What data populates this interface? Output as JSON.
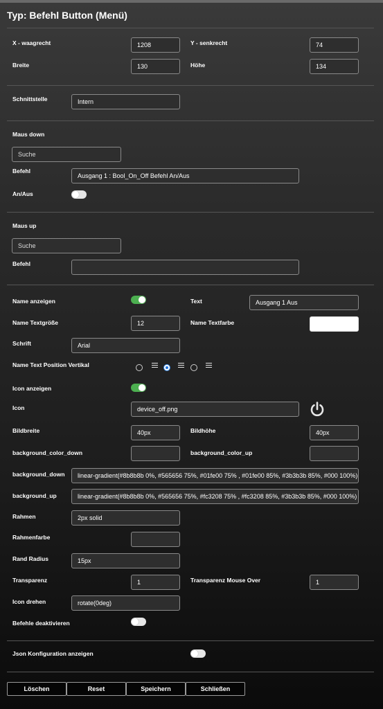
{
  "dialog": {
    "title": "Typ: Befehl Button (Menü)"
  },
  "position": {
    "x_label": "X - waagrecht",
    "x_value": "1208",
    "y_label": "Y - senkrecht",
    "y_value": "74",
    "width_label": "Breite",
    "width_value": "130",
    "height_label": "Höhe",
    "height_value": "134"
  },
  "interface": {
    "label": "Schnittstelle",
    "value": "Intern"
  },
  "mouse_down": {
    "heading": "Maus down",
    "search_value": "Suche",
    "command_label": "Befehl",
    "command_value": "Ausgang 1 : Bool_On_Off Befehl An/Aus",
    "onoff_label": "An/Aus",
    "onoff_state": "off"
  },
  "mouse_up": {
    "heading": "Maus up",
    "search_value": "Suche",
    "command_label": "Befehl",
    "command_value": ""
  },
  "appearance": {
    "show_name_label": "Name anzeigen",
    "show_name_state": "on",
    "text_label": "Text",
    "text_value": "Ausgang 1 Aus",
    "name_size_label": "Name Textgröße",
    "name_size_value": "12",
    "name_color_label": "Name Textfarbe",
    "name_color_value": "#ffffff",
    "font_label": "Schrift",
    "font_value": "Arial",
    "text_pos_label": "Name Text Position Vertikal",
    "text_pos_options": [
      "top",
      "middle",
      "bottom"
    ],
    "text_pos_selected": "middle",
    "show_icon_label": "Icon anzeigen",
    "show_icon_state": "on",
    "icon_label": "Icon",
    "icon_value": "device_off.png",
    "icon_preview": "power-icon",
    "img_width_label": "Bildbreite",
    "img_width_value": "40px",
    "img_height_label": "Bildhöhe",
    "img_height_value": "40px",
    "bg_color_down_label": "background_color_down",
    "bg_color_down_value": "",
    "bg_color_up_label": "background_color_up",
    "bg_color_up_value": "",
    "bg_down_label": "background_down",
    "bg_down_value": "linear-gradient(#8b8b8b 0%, #565656 75%, #01fe00 75% , #01fe00 85%,  #3b3b3b 85%,  #000 100%)",
    "bg_up_label": "background_up",
    "bg_up_value": "linear-gradient(#8b8b8b 0%, #565656 75%, #fc3208 75% , #fc3208 85%,  #3b3b3b 85%,  #000 100%)",
    "border_label": "Rahmen",
    "border_value": "2px solid",
    "border_color_label": "Rahmenfarbe",
    "border_color_value": "",
    "radius_label": "Rand Radius",
    "radius_value": "15px",
    "opacity_label": "Transparenz",
    "opacity_value": "1",
    "opacity_hover_label": "Transparenz Mouse Over",
    "opacity_hover_value": "1",
    "rotate_label": "Icon drehen",
    "rotate_value": "rotate(0deg)",
    "disable_label": "Befehle deaktivieren",
    "disable_state": "off"
  },
  "json_config": {
    "label": "Json Konfiguration anzeigen",
    "state": "off"
  },
  "buttons": {
    "delete": "Löschen",
    "reset": "Reset",
    "save": "Speichern",
    "close": "Schließen"
  },
  "colors": {
    "toggle_on": "#4caf50",
    "radio_selected": "#1e73e0",
    "input_border": "#8a8a8a"
  }
}
